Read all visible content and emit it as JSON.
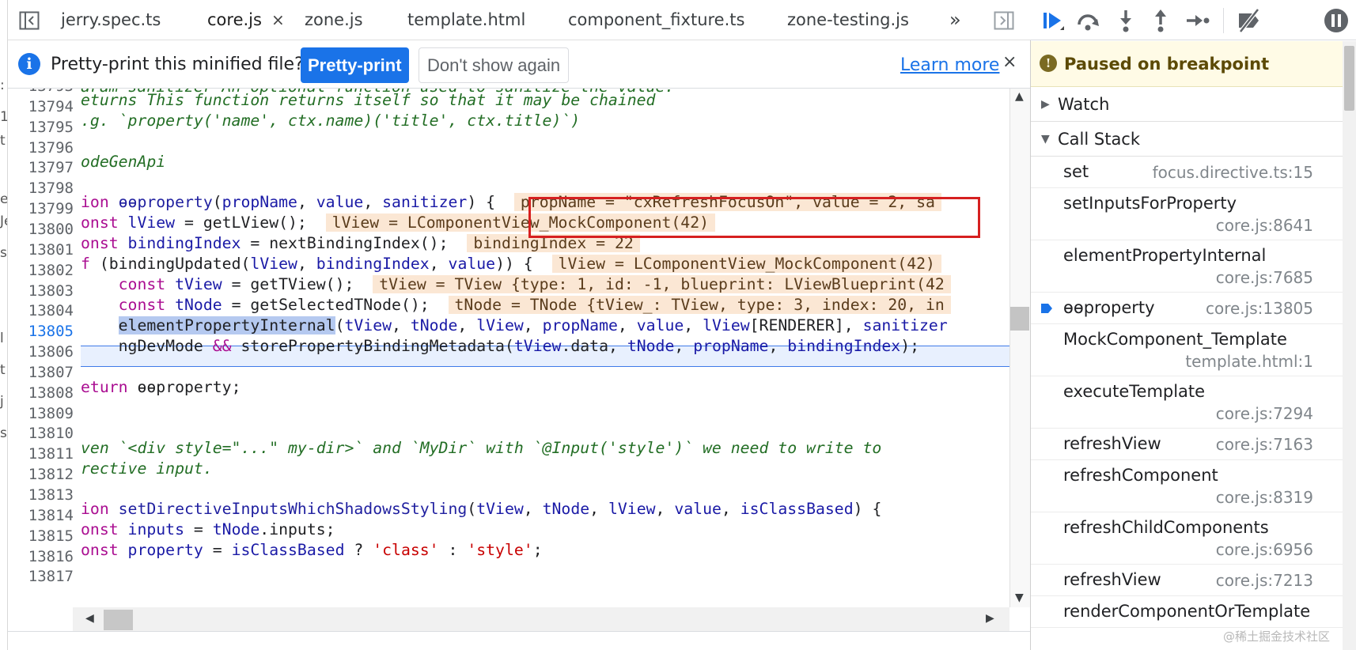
{
  "tabs": [
    {
      "label": "jerry.spec.ts",
      "active": false
    },
    {
      "label": "core.js",
      "active": true,
      "close": "×"
    },
    {
      "label": "zone.js",
      "active": false
    },
    {
      "label": "template.html",
      "active": false
    },
    {
      "label": "component_fixture.ts",
      "active": false
    },
    {
      "label": "zone-testing.js",
      "active": false
    }
  ],
  "tabs_overflow": "»",
  "infobar": {
    "message": "Pretty-print this minified file?",
    "pretty_print": "Pretty-print",
    "dont_show": "Don't show again",
    "learn_more": "Learn more",
    "close": "×",
    "info_glyph": "i"
  },
  "editor": {
    "line_numbers": [
      "13793",
      "13794",
      "13795",
      "13796",
      "13797",
      "13798",
      "13799",
      "13800",
      "13801",
      "13802",
      "13803",
      "13804",
      "13805",
      "13806",
      "13807",
      "13808",
      "13809",
      "13810",
      "13811",
      "13812",
      "13813",
      "13814",
      "13815",
      "13816",
      "13817"
    ],
    "current_line": "13805",
    "inline_values": {
      "l13799": "propName = \"cxRefreshFocusOn\", value = 2, sa",
      "l13800": "lView = LComponentView_MockComponent(42)",
      "l13801": "bindingIndex = 22",
      "l13802": "lView = LComponentView_MockComponent(42)",
      "l13803": "tView = TView {type: 1, id: -1, blueprint: LViewBlueprint(42",
      "l13804": "tNode = TNode {tView_: TView, type: 3, index: 20, in"
    }
  },
  "debugger": {
    "paused_message": "Paused on breakpoint",
    "paused_glyph": "!",
    "sections": {
      "watch": "Watch",
      "call_stack": "Call Stack"
    },
    "call_stack": [
      {
        "name": "set",
        "location": "focus.directive.ts:15"
      },
      {
        "name": "setInputsForProperty",
        "location": "core.js:8641"
      },
      {
        "name": "elementPropertyInternal",
        "location": "core.js:7685"
      },
      {
        "name": "ɵɵproperty",
        "location": "core.js:13805",
        "current": true
      },
      {
        "name": "MockComponent_Template",
        "location": "template.html:1"
      },
      {
        "name": "executeTemplate",
        "location": "core.js:7294"
      },
      {
        "name": "refreshView",
        "location": "core.js:7163"
      },
      {
        "name": "refreshComponent",
        "location": "core.js:8319"
      },
      {
        "name": "refreshChildComponents",
        "location": "core.js:6956"
      },
      {
        "name": "refreshView",
        "location": "core.js:7213"
      },
      {
        "name": "renderComponentOrTemplate",
        "location": ""
      }
    ]
  },
  "watermark": "@稀土掘金技术社区",
  "colors": {
    "accent": "#1a73e8",
    "paused_bg": "#fffbe6",
    "highlight_box": "#d62020",
    "inline_value_bg": "#fbe7d4"
  }
}
